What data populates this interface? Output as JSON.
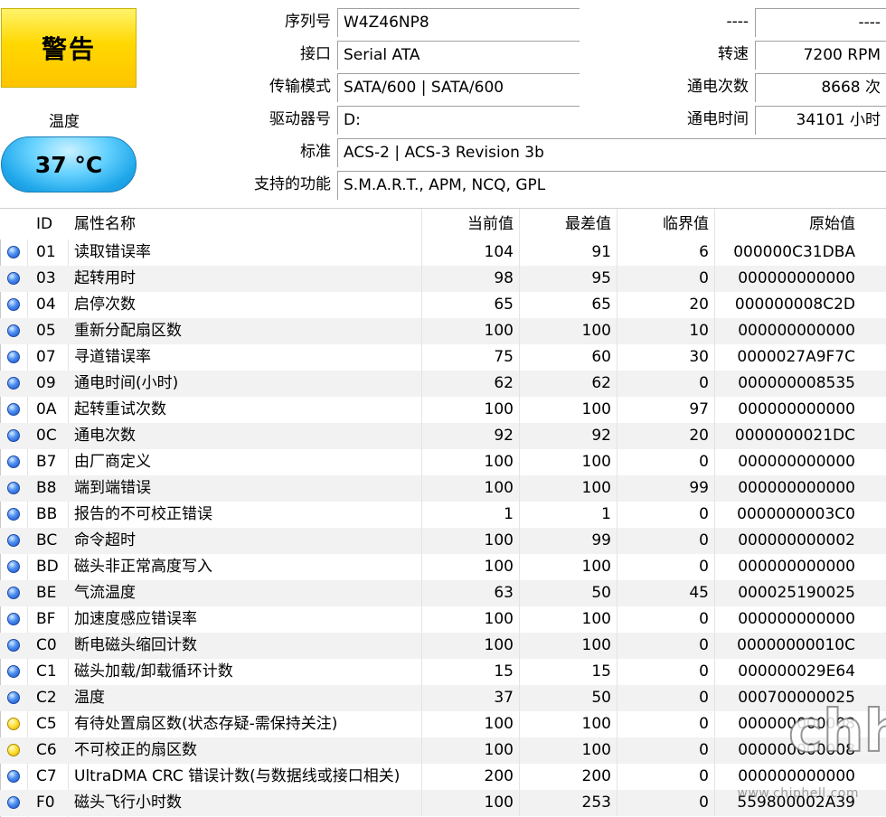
{
  "status": {
    "label": "警告",
    "color": "#ffd800"
  },
  "temperature": {
    "label": "温度",
    "value": "37 °C",
    "color": "#39b8f5"
  },
  "info_left": [
    {
      "label": "序列号",
      "value": "W4Z46NP8"
    },
    {
      "label": "接口",
      "value": "Serial ATA"
    },
    {
      "label": "传输模式",
      "value": "SATA/600 | SATA/600"
    },
    {
      "label": "驱动器号",
      "value": "D:"
    },
    {
      "label": "标准",
      "value": "ACS-2 | ACS-3 Revision 3b"
    },
    {
      "label": "支持的功能",
      "value": "S.M.A.R.T., APM, NCQ, GPL"
    }
  ],
  "info_right": [
    {
      "label": "----",
      "value": "----"
    },
    {
      "label": "转速",
      "value": "7200 RPM"
    },
    {
      "label": "通电次数",
      "value": "8668 次"
    },
    {
      "label": "通电时间",
      "value": "34101 小时"
    }
  ],
  "table": {
    "headers": {
      "id": "ID",
      "name": "属性名称",
      "current": "当前值",
      "worst": "最差值",
      "threshold": "临界值",
      "raw": "原始值"
    },
    "rows": [
      {
        "status": "blue",
        "id": "01",
        "name": "读取错误率",
        "current": "104",
        "worst": "91",
        "threshold": "6",
        "raw": "000000C31DBA"
      },
      {
        "status": "blue",
        "id": "03",
        "name": "起转用时",
        "current": "98",
        "worst": "95",
        "threshold": "0",
        "raw": "000000000000"
      },
      {
        "status": "blue",
        "id": "04",
        "name": "启停次数",
        "current": "65",
        "worst": "65",
        "threshold": "20",
        "raw": "000000008C2D"
      },
      {
        "status": "blue",
        "id": "05",
        "name": "重新分配扇区数",
        "current": "100",
        "worst": "100",
        "threshold": "10",
        "raw": "000000000000"
      },
      {
        "status": "blue",
        "id": "07",
        "name": "寻道错误率",
        "current": "75",
        "worst": "60",
        "threshold": "30",
        "raw": "0000027A9F7C"
      },
      {
        "status": "blue",
        "id": "09",
        "name": "通电时间(小时)",
        "current": "62",
        "worst": "62",
        "threshold": "0",
        "raw": "000000008535"
      },
      {
        "status": "blue",
        "id": "0A",
        "name": "起转重试次数",
        "current": "100",
        "worst": "100",
        "threshold": "97",
        "raw": "000000000000"
      },
      {
        "status": "blue",
        "id": "0C",
        "name": "通电次数",
        "current": "92",
        "worst": "92",
        "threshold": "20",
        "raw": "0000000021DC"
      },
      {
        "status": "blue",
        "id": "B7",
        "name": "由厂商定义",
        "current": "100",
        "worst": "100",
        "threshold": "0",
        "raw": "000000000000"
      },
      {
        "status": "blue",
        "id": "B8",
        "name": "端到端错误",
        "current": "100",
        "worst": "100",
        "threshold": "99",
        "raw": "000000000000"
      },
      {
        "status": "blue",
        "id": "BB",
        "name": "报告的不可校正错误",
        "current": "1",
        "worst": "1",
        "threshold": "0",
        "raw": "0000000003C0"
      },
      {
        "status": "blue",
        "id": "BC",
        "name": "命令超时",
        "current": "100",
        "worst": "99",
        "threshold": "0",
        "raw": "000000000002"
      },
      {
        "status": "blue",
        "id": "BD",
        "name": "磁头非正常高度写入",
        "current": "100",
        "worst": "100",
        "threshold": "0",
        "raw": "000000000000"
      },
      {
        "status": "blue",
        "id": "BE",
        "name": "气流温度",
        "current": "63",
        "worst": "50",
        "threshold": "45",
        "raw": "000025190025"
      },
      {
        "status": "blue",
        "id": "BF",
        "name": "加速度感应错误率",
        "current": "100",
        "worst": "100",
        "threshold": "0",
        "raw": "000000000000"
      },
      {
        "status": "blue",
        "id": "C0",
        "name": "断电磁头缩回计数",
        "current": "100",
        "worst": "100",
        "threshold": "0",
        "raw": "00000000010C"
      },
      {
        "status": "blue",
        "id": "C1",
        "name": "磁头加载/卸载循环计数",
        "current": "15",
        "worst": "15",
        "threshold": "0",
        "raw": "000000029E64"
      },
      {
        "status": "blue",
        "id": "C2",
        "name": "温度",
        "current": "37",
        "worst": "50",
        "threshold": "0",
        "raw": "000700000025"
      },
      {
        "status": "yellow",
        "id": "C5",
        "name": "有待处置扇区数(状态存疑-需保持关注)",
        "current": "100",
        "worst": "100",
        "threshold": "0",
        "raw": "000000000008"
      },
      {
        "status": "yellow",
        "id": "C6",
        "name": "不可校正的扇区数",
        "current": "100",
        "worst": "100",
        "threshold": "0",
        "raw": "000000000008"
      },
      {
        "status": "blue",
        "id": "C7",
        "name": "UltraDMA CRC 错误计数(与数据线或接口相关)",
        "current": "200",
        "worst": "200",
        "threshold": "0",
        "raw": "000000000000"
      },
      {
        "status": "blue",
        "id": "F0",
        "name": "磁头飞行小时数",
        "current": "100",
        "worst": "253",
        "threshold": "0",
        "raw": "559800002A39"
      }
    ]
  },
  "watermark": {
    "text": "www.chiphell.com",
    "logo": "chh"
  }
}
